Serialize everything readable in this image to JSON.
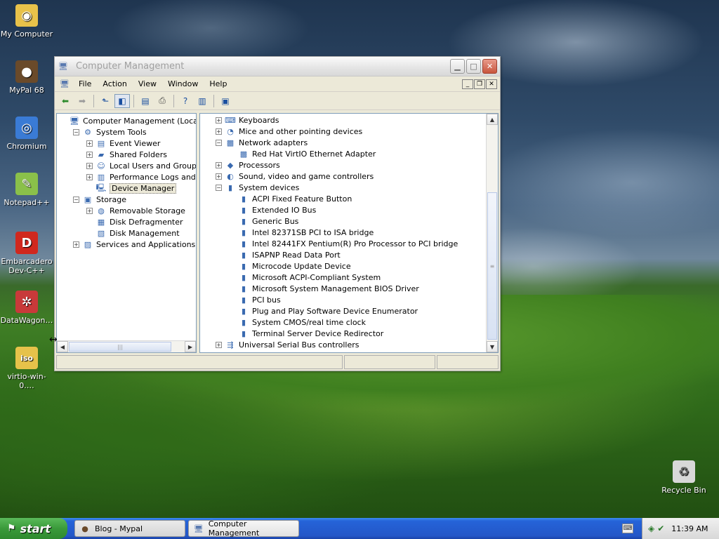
{
  "desktop": {
    "icons": [
      {
        "label": "My Computer",
        "icon": "my-computer-icon",
        "color": "#e8c24a",
        "glyph": "◉"
      },
      {
        "label": "MyPal 68",
        "icon": "mypal-icon",
        "color": "#6a4a2a",
        "glyph": "●"
      },
      {
        "label": "Chromium",
        "icon": "chromium-icon",
        "color": "#3a7bd5",
        "glyph": "◎"
      },
      {
        "label": "Notepad++",
        "icon": "notepad-plus-plus-icon",
        "color": "#8ac04a",
        "glyph": "✎"
      },
      {
        "label": "Embarcadero Dev-C++",
        "icon": "dev-cpp-icon",
        "color": "#d0281e",
        "glyph": "D"
      },
      {
        "label": "DataWagon…",
        "icon": "datawagon-icon",
        "color": "#c83a3a",
        "glyph": "✲"
      },
      {
        "label": "virtio-win-0.…",
        "icon": "iso-file-icon",
        "color": "#e6c24a",
        "glyph": "iso"
      }
    ],
    "recycle_bin": {
      "label": "Recycle Bin",
      "icon": "recycle-bin-icon"
    }
  },
  "window": {
    "title": "Computer Management",
    "menu": [
      "File",
      "Action",
      "View",
      "Window",
      "Help"
    ],
    "left_tree": [
      {
        "label": "Computer Management (Local)",
        "depth": 0,
        "expander": "",
        "icon": "computer-management-icon",
        "glyph": "🖥"
      },
      {
        "label": "System Tools",
        "depth": 1,
        "expander": "−",
        "icon": "system-tools-icon",
        "glyph": "⚙"
      },
      {
        "label": "Event Viewer",
        "depth": 2,
        "expander": "+",
        "icon": "event-viewer-icon",
        "glyph": "▤"
      },
      {
        "label": "Shared Folders",
        "depth": 2,
        "expander": "+",
        "icon": "shared-folders-icon",
        "glyph": "▰"
      },
      {
        "label": "Local Users and Groups",
        "depth": 2,
        "expander": "+",
        "icon": "users-icon",
        "glyph": "☺"
      },
      {
        "label": "Performance Logs and Alerts",
        "depth": 2,
        "expander": "+",
        "icon": "performance-icon",
        "glyph": "▥"
      },
      {
        "label": "Device Manager",
        "depth": 2,
        "expander": "",
        "icon": "device-manager-icon",
        "glyph": "🖳",
        "selected": true
      },
      {
        "label": "Storage",
        "depth": 1,
        "expander": "−",
        "icon": "storage-icon",
        "glyph": "▣"
      },
      {
        "label": "Removable Storage",
        "depth": 2,
        "expander": "+",
        "icon": "removable-storage-icon",
        "glyph": "◍"
      },
      {
        "label": "Disk Defragmenter",
        "depth": 2,
        "expander": "",
        "icon": "defrag-icon",
        "glyph": "▦"
      },
      {
        "label": "Disk Management",
        "depth": 2,
        "expander": "",
        "icon": "disk-management-icon",
        "glyph": "▧"
      },
      {
        "label": "Services and Applications",
        "depth": 1,
        "expander": "+",
        "icon": "services-icon",
        "glyph": "▨"
      }
    ],
    "right_tree": [
      {
        "label": "Keyboards",
        "depth": 0,
        "expander": "+",
        "icon": "keyboard-icon",
        "glyph": "⌨"
      },
      {
        "label": "Mice and other pointing devices",
        "depth": 0,
        "expander": "+",
        "icon": "mouse-icon",
        "glyph": "◔"
      },
      {
        "label": "Network adapters",
        "depth": 0,
        "expander": "−",
        "icon": "network-adapter-icon",
        "glyph": "▩"
      },
      {
        "label": "Red Hat VirtIO Ethernet Adapter",
        "depth": 1,
        "expander": "",
        "icon": "ethernet-adapter-icon",
        "glyph": "▩"
      },
      {
        "label": "Processors",
        "depth": 0,
        "expander": "+",
        "icon": "processor-icon",
        "glyph": "◆"
      },
      {
        "label": "Sound, video and game controllers",
        "depth": 0,
        "expander": "+",
        "icon": "sound-icon",
        "glyph": "◐"
      },
      {
        "label": "System devices",
        "depth": 0,
        "expander": "−",
        "icon": "system-devices-icon",
        "glyph": "▮"
      },
      {
        "label": "ACPI Fixed Feature Button",
        "depth": 1,
        "expander": "",
        "icon": "device-icon",
        "glyph": "▮"
      },
      {
        "label": "Extended IO Bus",
        "depth": 1,
        "expander": "",
        "icon": "device-icon",
        "glyph": "▮"
      },
      {
        "label": "Generic Bus",
        "depth": 1,
        "expander": "",
        "icon": "device-icon",
        "glyph": "▮"
      },
      {
        "label": "Intel 82371SB PCI to ISA bridge",
        "depth": 1,
        "expander": "",
        "icon": "device-icon",
        "glyph": "▮"
      },
      {
        "label": "Intel 82441FX Pentium(R) Pro Processor to PCI bridge",
        "depth": 1,
        "expander": "",
        "icon": "device-icon",
        "glyph": "▮"
      },
      {
        "label": "ISAPNP Read Data Port",
        "depth": 1,
        "expander": "",
        "icon": "device-icon",
        "glyph": "▮"
      },
      {
        "label": "Microcode Update Device",
        "depth": 1,
        "expander": "",
        "icon": "device-icon",
        "glyph": "▮"
      },
      {
        "label": "Microsoft ACPI-Compliant System",
        "depth": 1,
        "expander": "",
        "icon": "device-icon",
        "glyph": "▮"
      },
      {
        "label": "Microsoft System Management BIOS Driver",
        "depth": 1,
        "expander": "",
        "icon": "device-icon",
        "glyph": "▮"
      },
      {
        "label": "PCI bus",
        "depth": 1,
        "expander": "",
        "icon": "device-icon",
        "glyph": "▮"
      },
      {
        "label": "Plug and Play Software Device Enumerator",
        "depth": 1,
        "expander": "",
        "icon": "device-icon",
        "glyph": "▮"
      },
      {
        "label": "System CMOS/real time clock",
        "depth": 1,
        "expander": "",
        "icon": "device-icon",
        "glyph": "▮"
      },
      {
        "label": "Terminal Server Device Redirector",
        "depth": 1,
        "expander": "",
        "icon": "device-icon",
        "glyph": "▮"
      },
      {
        "label": "Universal Serial Bus controllers",
        "depth": 0,
        "expander": "+",
        "icon": "usb-icon",
        "glyph": "⇶"
      }
    ]
  },
  "taskbar": {
    "start_label": "start",
    "tasks": [
      {
        "label": "Blog - Mypal",
        "icon": "mypal-task-icon"
      },
      {
        "label": "Computer Management",
        "icon": "computer-management-task-icon"
      }
    ],
    "clock": "11:39 AM"
  }
}
